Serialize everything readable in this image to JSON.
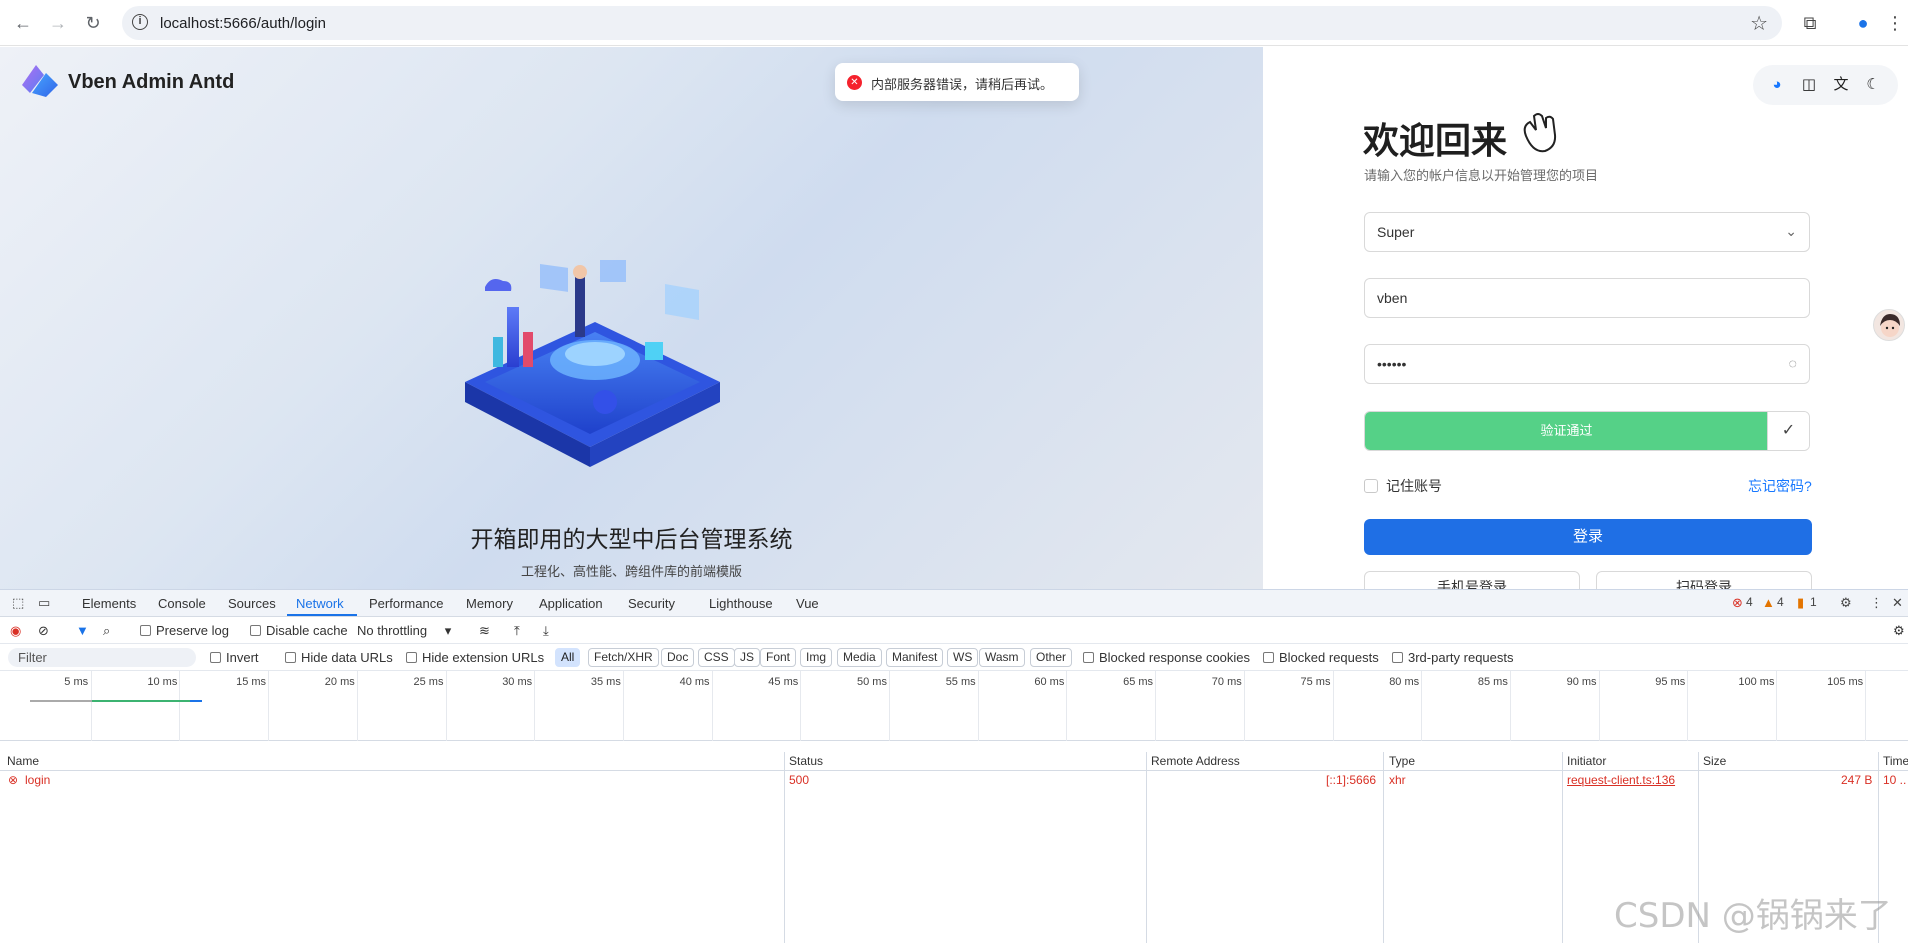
{
  "browser": {
    "url": "localhost:5666/auth/login"
  },
  "page": {
    "brand": "Vben Admin Antd",
    "slogan": "开箱即用的大型中后台管理系统",
    "sub_slogan": "工程化、高性能、跨组件库的前端模版",
    "toast": "内部服务器错误，请稍后再试。",
    "welcome_title": "欢迎回来",
    "welcome_sub": "请输入您的帐户信息以开始管理您的项目",
    "account_select": "Super",
    "username": "vben",
    "password": "••••••",
    "captcha_label": "验证通过",
    "remember_label": "记住账号",
    "forgot_label": "忘记密码?",
    "login_label": "登录",
    "alt_login_1": "手机号登录",
    "alt_login_2": "扫码登录",
    "colors": {
      "primary": "#1f6fe5",
      "success": "#55d187",
      "error": "#f5222d"
    }
  },
  "devtools": {
    "tabs": [
      "Elements",
      "Console",
      "Sources",
      "Network",
      "Performance",
      "Memory",
      "Application",
      "Security",
      "Lighthouse",
      "Vue"
    ],
    "active_tab": "Network",
    "counts": {
      "errors": "4",
      "warnings": "4",
      "issues": "1"
    },
    "toolbar": {
      "preserve_log": "Preserve log",
      "disable_cache": "Disable cache",
      "throttling": "No throttling"
    },
    "filter": {
      "placeholder": "Filter",
      "invert": "Invert",
      "hide_data_urls": "Hide data URLs",
      "hide_ext_urls": "Hide extension URLs",
      "types": [
        "All",
        "Fetch/XHR",
        "Doc",
        "CSS",
        "JS",
        "Font",
        "Img",
        "Media",
        "Manifest",
        "WS",
        "Wasm",
        "Other"
      ],
      "blocked_cookies": "Blocked response cookies",
      "blocked_requests": "Blocked requests",
      "third_party": "3rd-party requests"
    },
    "timeline_ticks": [
      "5 ms",
      "10 ms",
      "15 ms",
      "20 ms",
      "25 ms",
      "30 ms",
      "35 ms",
      "40 ms",
      "45 ms",
      "50 ms",
      "55 ms",
      "60 ms",
      "65 ms",
      "70 ms",
      "75 ms",
      "80 ms",
      "85 ms",
      "90 ms",
      "95 ms",
      "100 ms",
      "105 ms"
    ],
    "columns": [
      "Name",
      "Status",
      "Remote Address",
      "Type",
      "Initiator",
      "Size",
      "Time"
    ],
    "requests": [
      {
        "name": "login",
        "status": "500",
        "remote": "[::1]:5666",
        "type": "xhr",
        "initiator": "request-client.ts:136",
        "size": "247 B",
        "time": "10 .."
      }
    ]
  },
  "watermark": "CSDN @锅锅来了"
}
